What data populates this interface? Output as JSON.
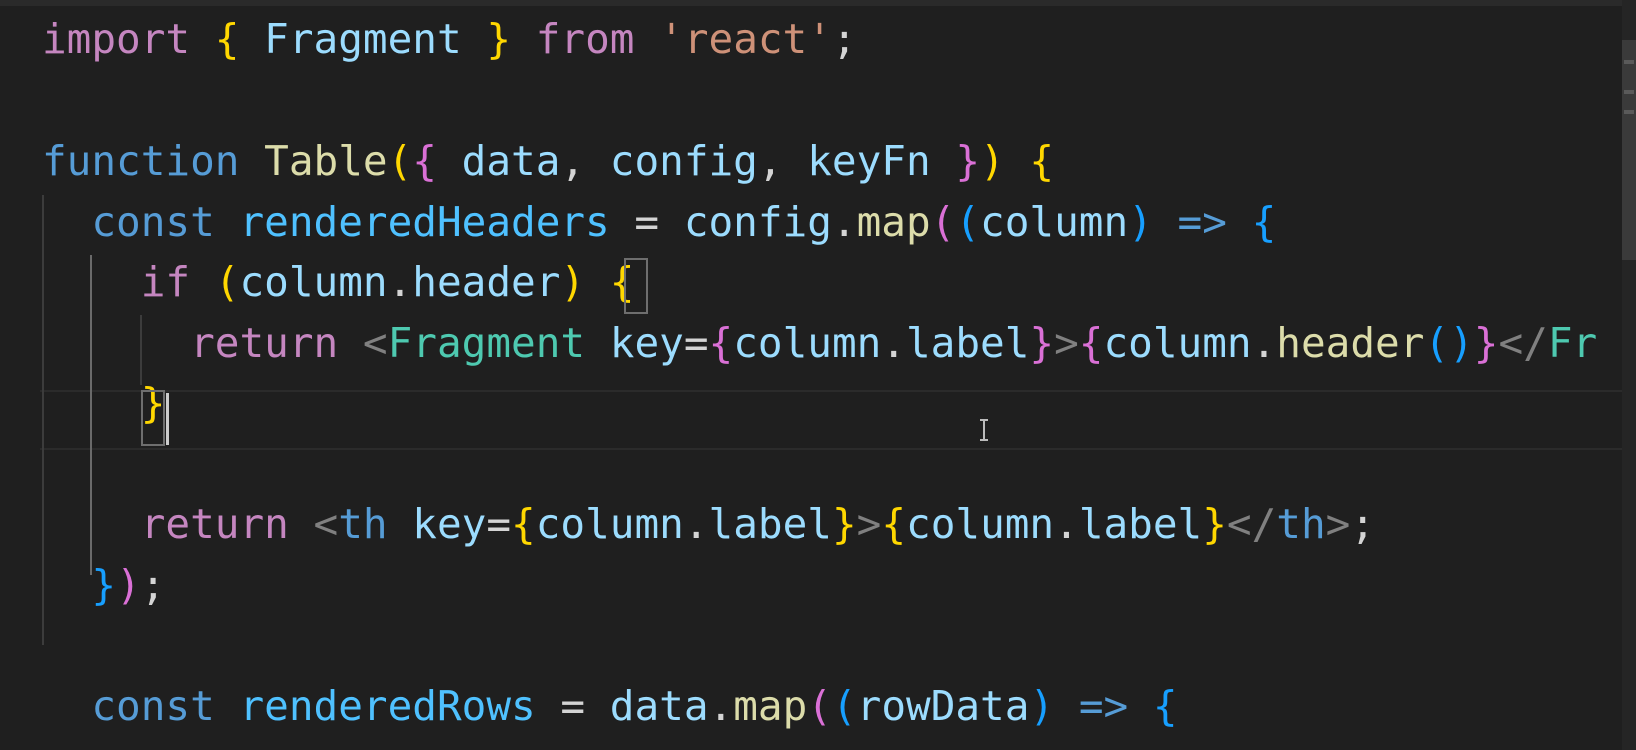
{
  "theme": {
    "background": "#1f1f1f",
    "keyword_purple": "#c586c0",
    "keyword_blue": "#569cd6",
    "identifier": "#9cdcfe",
    "function": "#dcdcaa",
    "string": "#ce9178",
    "jsx_tag": "#4ec9b0",
    "tag_bracket": "#808080",
    "brace_yellow": "#ffd700",
    "brace_pink": "#da70d6",
    "brace_blue": "#179fff",
    "plain": "#d4d4d4"
  },
  "editor": {
    "lines": [
      [
        {
          "t": "import",
          "c": "#c586c0"
        },
        {
          "t": " ",
          "c": "#d4d4d4"
        },
        {
          "t": "{",
          "c": "#ffd700"
        },
        {
          "t": " Fragment ",
          "c": "#9cdcfe"
        },
        {
          "t": "}",
          "c": "#ffd700"
        },
        {
          "t": " ",
          "c": "#d4d4d4"
        },
        {
          "t": "from",
          "c": "#c586c0"
        },
        {
          "t": " ",
          "c": "#d4d4d4"
        },
        {
          "t": "'react'",
          "c": "#ce9178"
        },
        {
          "t": ";",
          "c": "#d4d4d4"
        }
      ],
      [],
      [
        {
          "t": "function",
          "c": "#569cd6"
        },
        {
          "t": " ",
          "c": "#d4d4d4"
        },
        {
          "t": "Table",
          "c": "#dcdcaa"
        },
        {
          "t": "(",
          "c": "#ffd700"
        },
        {
          "t": "{",
          "c": "#da70d6"
        },
        {
          "t": " data",
          "c": "#9cdcfe"
        },
        {
          "t": ",",
          "c": "#d4d4d4"
        },
        {
          "t": " config",
          "c": "#9cdcfe"
        },
        {
          "t": ",",
          "c": "#d4d4d4"
        },
        {
          "t": " keyFn ",
          "c": "#9cdcfe"
        },
        {
          "t": "}",
          "c": "#da70d6"
        },
        {
          "t": ")",
          "c": "#ffd700"
        },
        {
          "t": " ",
          "c": "#d4d4d4"
        },
        {
          "t": "{",
          "c": "#ffd700"
        }
      ],
      [
        {
          "t": "  ",
          "c": "#d4d4d4"
        },
        {
          "t": "const",
          "c": "#569cd6"
        },
        {
          "t": " ",
          "c": "#d4d4d4"
        },
        {
          "t": "renderedHeaders",
          "c": "#4fc1ff"
        },
        {
          "t": " = ",
          "c": "#d4d4d4"
        },
        {
          "t": "config",
          "c": "#9cdcfe"
        },
        {
          "t": ".",
          "c": "#d4d4d4"
        },
        {
          "t": "map",
          "c": "#dcdcaa"
        },
        {
          "t": "(",
          "c": "#da70d6"
        },
        {
          "t": "(",
          "c": "#179fff"
        },
        {
          "t": "column",
          "c": "#9cdcfe"
        },
        {
          "t": ")",
          "c": "#179fff"
        },
        {
          "t": " ",
          "c": "#d4d4d4"
        },
        {
          "t": "=>",
          "c": "#569cd6"
        },
        {
          "t": " ",
          "c": "#d4d4d4"
        },
        {
          "t": "{",
          "c": "#179fff"
        }
      ],
      [
        {
          "t": "    ",
          "c": "#d4d4d4"
        },
        {
          "t": "if",
          "c": "#c586c0"
        },
        {
          "t": " ",
          "c": "#d4d4d4"
        },
        {
          "t": "(",
          "c": "#ffd700"
        },
        {
          "t": "column",
          "c": "#9cdcfe"
        },
        {
          "t": ".",
          "c": "#d4d4d4"
        },
        {
          "t": "header",
          "c": "#9cdcfe"
        },
        {
          "t": ")",
          "c": "#ffd700"
        },
        {
          "t": " ",
          "c": "#d4d4d4"
        },
        {
          "t": "{",
          "c": "#ffd700"
        }
      ],
      [
        {
          "t": "      ",
          "c": "#d4d4d4"
        },
        {
          "t": "return",
          "c": "#c586c0"
        },
        {
          "t": " ",
          "c": "#d4d4d4"
        },
        {
          "t": "<",
          "c": "#808080"
        },
        {
          "t": "Fragment",
          "c": "#4ec9b0"
        },
        {
          "t": " ",
          "c": "#d4d4d4"
        },
        {
          "t": "key",
          "c": "#9cdcfe"
        },
        {
          "t": "=",
          "c": "#d4d4d4"
        },
        {
          "t": "{",
          "c": "#da70d6"
        },
        {
          "t": "column",
          "c": "#9cdcfe"
        },
        {
          "t": ".",
          "c": "#d4d4d4"
        },
        {
          "t": "label",
          "c": "#9cdcfe"
        },
        {
          "t": "}",
          "c": "#da70d6"
        },
        {
          "t": ">",
          "c": "#808080"
        },
        {
          "t": "{",
          "c": "#da70d6"
        },
        {
          "t": "column",
          "c": "#9cdcfe"
        },
        {
          "t": ".",
          "c": "#d4d4d4"
        },
        {
          "t": "header",
          "c": "#dcdcaa"
        },
        {
          "t": "()",
          "c": "#179fff"
        },
        {
          "t": "}",
          "c": "#da70d6"
        },
        {
          "t": "</",
          "c": "#808080"
        },
        {
          "t": "Fr",
          "c": "#4ec9b0"
        }
      ],
      [
        {
          "t": "    ",
          "c": "#d4d4d4"
        },
        {
          "t": "}",
          "c": "#ffd700"
        }
      ],
      [],
      [
        {
          "t": "    ",
          "c": "#d4d4d4"
        },
        {
          "t": "return",
          "c": "#c586c0"
        },
        {
          "t": " ",
          "c": "#d4d4d4"
        },
        {
          "t": "<",
          "c": "#808080"
        },
        {
          "t": "th",
          "c": "#569cd6"
        },
        {
          "t": " ",
          "c": "#d4d4d4"
        },
        {
          "t": "key",
          "c": "#9cdcfe"
        },
        {
          "t": "=",
          "c": "#d4d4d4"
        },
        {
          "t": "{",
          "c": "#ffd700"
        },
        {
          "t": "column",
          "c": "#9cdcfe"
        },
        {
          "t": ".",
          "c": "#d4d4d4"
        },
        {
          "t": "label",
          "c": "#9cdcfe"
        },
        {
          "t": "}",
          "c": "#ffd700"
        },
        {
          "t": ">",
          "c": "#808080"
        },
        {
          "t": "{",
          "c": "#ffd700"
        },
        {
          "t": "column",
          "c": "#9cdcfe"
        },
        {
          "t": ".",
          "c": "#d4d4d4"
        },
        {
          "t": "label",
          "c": "#9cdcfe"
        },
        {
          "t": "}",
          "c": "#ffd700"
        },
        {
          "t": "</",
          "c": "#808080"
        },
        {
          "t": "th",
          "c": "#569cd6"
        },
        {
          "t": ">",
          "c": "#808080"
        },
        {
          "t": ";",
          "c": "#d4d4d4"
        }
      ],
      [
        {
          "t": "  ",
          "c": "#d4d4d4"
        },
        {
          "t": "}",
          "c": "#179fff"
        },
        {
          "t": ")",
          "c": "#da70d6"
        },
        {
          "t": ";",
          "c": "#d4d4d4"
        }
      ],
      [],
      [
        {
          "t": "  ",
          "c": "#d4d4d4"
        },
        {
          "t": "const",
          "c": "#569cd6"
        },
        {
          "t": " ",
          "c": "#d4d4d4"
        },
        {
          "t": "renderedRows",
          "c": "#4fc1ff"
        },
        {
          "t": " = ",
          "c": "#d4d4d4"
        },
        {
          "t": "data",
          "c": "#9cdcfe"
        },
        {
          "t": ".",
          "c": "#d4d4d4"
        },
        {
          "t": "map",
          "c": "#dcdcaa"
        },
        {
          "t": "(",
          "c": "#da70d6"
        },
        {
          "t": "(",
          "c": "#179fff"
        },
        {
          "t": "rowData",
          "c": "#9cdcfe"
        },
        {
          "t": ")",
          "c": "#179fff"
        },
        {
          "t": " ",
          "c": "#d4d4d4"
        },
        {
          "t": "=>",
          "c": "#569cd6"
        },
        {
          "t": " ",
          "c": "#d4d4d4"
        },
        {
          "t": "{",
          "c": "#179fff"
        }
      ]
    ]
  }
}
